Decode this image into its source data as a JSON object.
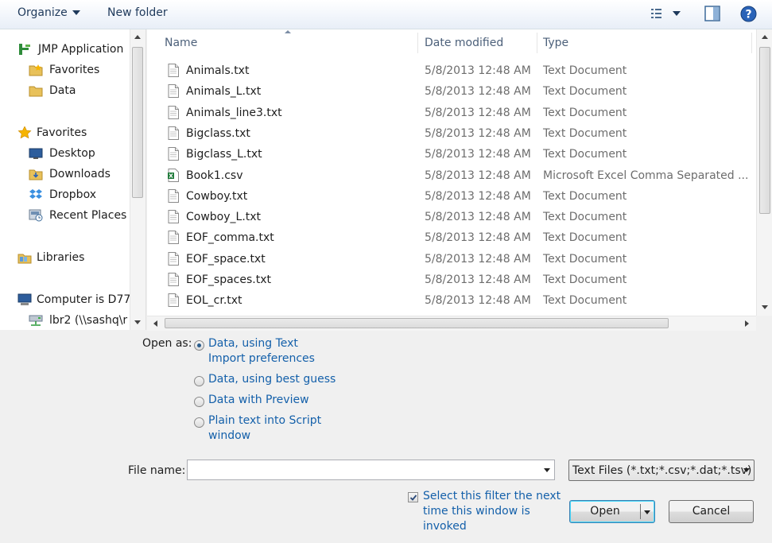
{
  "toolbar": {
    "organize_label": "Organize",
    "new_folder_label": "New folder",
    "icons": [
      "view-list-icon",
      "preview-pane-icon",
      "help-icon"
    ]
  },
  "nav": {
    "items": [
      {
        "label": "JMP Application",
        "icon": "jmp-icon"
      },
      {
        "label": "Favorites",
        "icon": "folder-star-icon"
      },
      {
        "label": "Data",
        "icon": "folder-icon"
      },
      {
        "label": "Favorites",
        "icon": "star-icon"
      },
      {
        "label": "Desktop",
        "icon": "desktop-icon"
      },
      {
        "label": "Downloads",
        "icon": "folder-icon"
      },
      {
        "label": "Dropbox",
        "icon": "dropbox-icon"
      },
      {
        "label": "Recent Places",
        "icon": "recent-places-icon"
      },
      {
        "label": "Libraries",
        "icon": "libraries-icon"
      },
      {
        "label": "Computer is D77",
        "icon": "computer-icon"
      },
      {
        "label": "lbr2 (\\\\sashq\\r",
        "icon": "network-drive-icon"
      }
    ]
  },
  "list": {
    "columns": [
      "Name",
      "Date modified",
      "Type"
    ],
    "rows": [
      {
        "name": "Animals.txt",
        "date": "5/8/2013 12:48 AM",
        "type": "Text Document",
        "icon": "text-file-icon"
      },
      {
        "name": "Animals_L.txt",
        "date": "5/8/2013 12:48 AM",
        "type": "Text Document",
        "icon": "text-file-icon"
      },
      {
        "name": "Animals_line3.txt",
        "date": "5/8/2013 12:48 AM",
        "type": "Text Document",
        "icon": "text-file-icon"
      },
      {
        "name": "Bigclass.txt",
        "date": "5/8/2013 12:48 AM",
        "type": "Text Document",
        "icon": "text-file-icon"
      },
      {
        "name": "Bigclass_L.txt",
        "date": "5/8/2013 12:48 AM",
        "type": "Text Document",
        "icon": "text-file-icon"
      },
      {
        "name": "Book1.csv",
        "date": "5/8/2013 12:48 AM",
        "type": "Microsoft Excel Comma Separated ...",
        "icon": "excel-file-icon"
      },
      {
        "name": "Cowboy.txt",
        "date": "5/8/2013 12:48 AM",
        "type": "Text Document",
        "icon": "text-file-icon"
      },
      {
        "name": "Cowboy_L.txt",
        "date": "5/8/2013 12:48 AM",
        "type": "Text Document",
        "icon": "text-file-icon"
      },
      {
        "name": "EOF_comma.txt",
        "date": "5/8/2013 12:48 AM",
        "type": "Text Document",
        "icon": "text-file-icon"
      },
      {
        "name": "EOF_space.txt",
        "date": "5/8/2013 12:48 AM",
        "type": "Text Document",
        "icon": "text-file-icon"
      },
      {
        "name": "EOF_spaces.txt",
        "date": "5/8/2013 12:48 AM",
        "type": "Text Document",
        "icon": "text-file-icon"
      },
      {
        "name": "EOL_cr.txt",
        "date": "5/8/2013 12:48 AM",
        "type": "Text Document",
        "icon": "text-file-icon"
      }
    ]
  },
  "open_as": {
    "label": "Open as:",
    "options": [
      {
        "line1": "Data, using Text",
        "line2": "Import preferences",
        "selected": true
      },
      {
        "line1": "Data, using best guess",
        "line2": "",
        "selected": false
      },
      {
        "line1": "Data with Preview",
        "line2": "",
        "selected": false
      },
      {
        "line1": "Plain text into Script",
        "line2": "window",
        "selected": false
      }
    ]
  },
  "file_name": {
    "label": "File name:",
    "value": ""
  },
  "filter": {
    "selected": "Text Files (*.txt;*.csv;*.dat;*.tsv)"
  },
  "remember_filter": {
    "line1": "Select this filter the next",
    "line2": "time this window is",
    "line3": "invoked",
    "checked": true
  },
  "buttons": {
    "open": "Open",
    "cancel": "Cancel"
  },
  "colors": {
    "link": "#1460aa",
    "toolbar_text": "#1e395b",
    "header_text": "#4c607a"
  }
}
